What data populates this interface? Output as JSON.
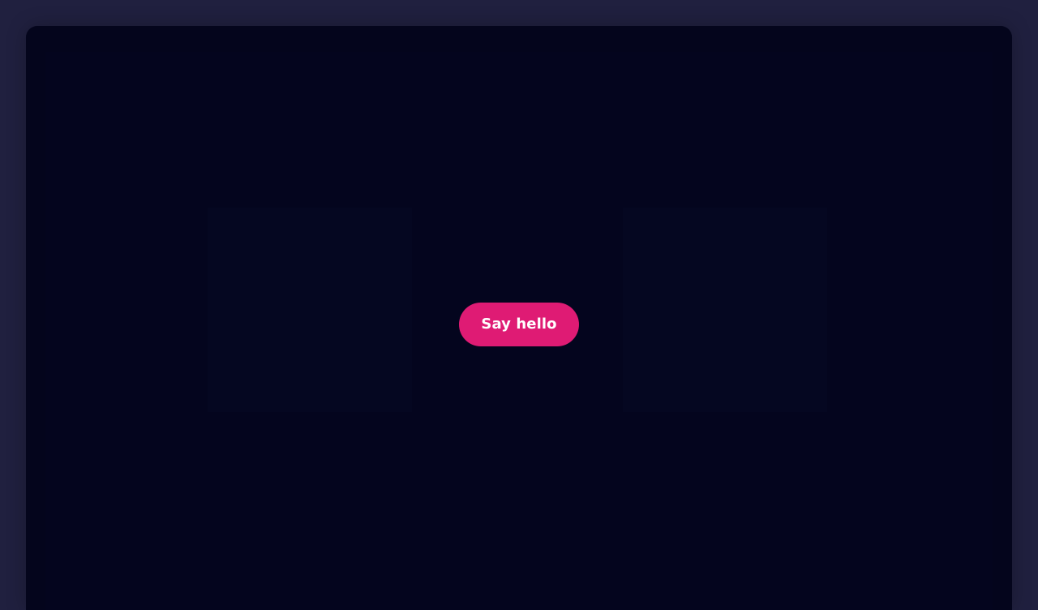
{
  "main": {
    "cta_label": "Say hello"
  },
  "colors": {
    "page_background": "#20203f",
    "frame_background": "#04051c",
    "panel_background": "#050721",
    "button_background": "#df1b74",
    "button_text": "#ffffff"
  }
}
